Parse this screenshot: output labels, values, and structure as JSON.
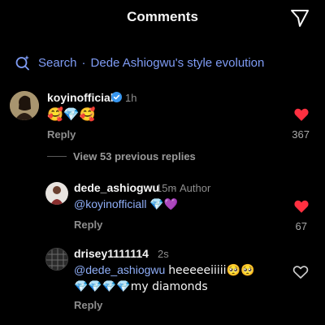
{
  "header": {
    "title": "Comments"
  },
  "search": {
    "label": "Search",
    "separator": "·",
    "query": "Dede Ashiogwu's style evolution"
  },
  "comments": [
    {
      "username": "koyinofficiall",
      "time": "1h",
      "text": "🥰💎🥰",
      "reply_label": "Reply",
      "likes": "367",
      "liked": true
    }
  ],
  "view_replies": "View 53 previous replies",
  "replies": [
    {
      "username": "dede_ashiogwu",
      "time": "15m",
      "author_label": "Author",
      "mention": "@koyinofficiall",
      "text_after": "💎💜",
      "reply_label": "Reply",
      "likes": "67",
      "liked": true
    },
    {
      "username": "drisey1111114",
      "time": "2s",
      "mention": "@dede_ashiogwu",
      "text_line1": "heeeeeiiiii🥺🥺",
      "text_line2": "💎💎💎💎my diamonds",
      "reply_label": "Reply",
      "liked": false
    }
  ],
  "colors": {
    "background": "#000000",
    "mention": "#8faef8",
    "like_red": "#ff3040",
    "verified_blue": "#3897f0"
  },
  "icons": [
    "send-icon",
    "search-sparkle-icon",
    "verified-badge-icon",
    "heart-filled-icon",
    "heart-outline-icon"
  ]
}
